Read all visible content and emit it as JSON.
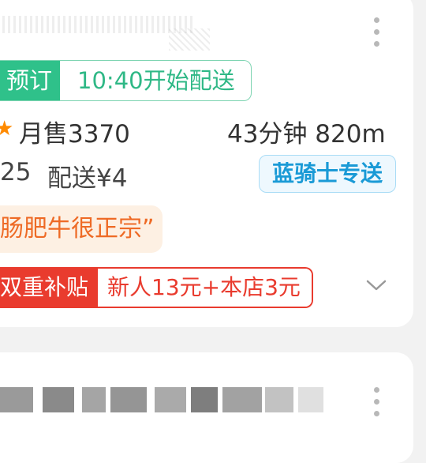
{
  "card": {
    "pre_order_badge": "预订",
    "delivery_start": "10:40开始配送",
    "monthly_sales": "月售3370",
    "delivery_time_distance": "43分钟 820m",
    "min_order_partial": "25",
    "delivery_fee": "配送¥4",
    "rider_badge": "蓝骑士专送",
    "review_snippet": "肠肥牛很正宗”",
    "promo_label": "双重补贴",
    "promo_detail": "新人13元+本店3元"
  },
  "colors": {
    "green": "#2fc18a",
    "blue": "#1a9ad6",
    "orange": "#ee6a25",
    "red": "#e93b2e"
  },
  "icons": {
    "more": "kebab-icon",
    "expand": "chevron-down-icon"
  }
}
